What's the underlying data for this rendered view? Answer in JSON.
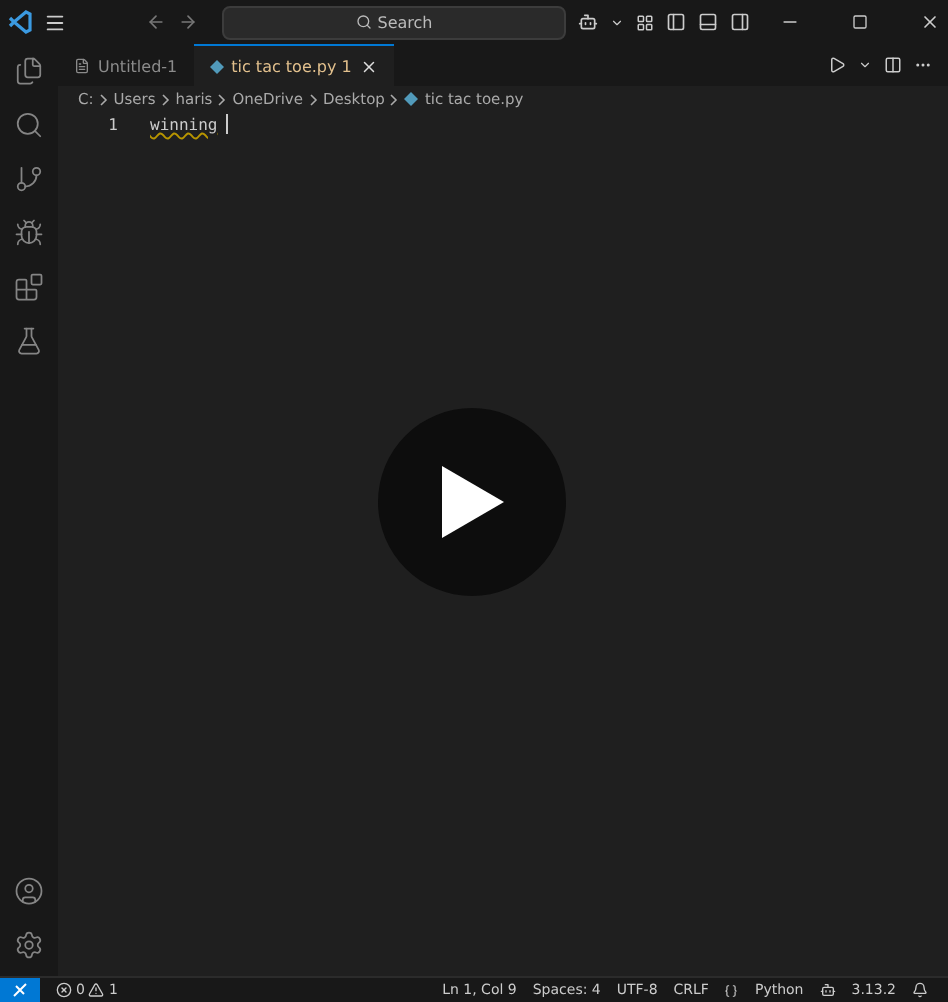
{
  "title_bar": {
    "search_placeholder": "Search"
  },
  "activity_bar": {
    "items": [
      {
        "kind": "explorer",
        "selected": false
      },
      {
        "kind": "search",
        "selected": false
      },
      {
        "kind": "source-control",
        "selected": false
      },
      {
        "kind": "run",
        "selected": false
      },
      {
        "kind": "extensions",
        "selected": false
      },
      {
        "kind": "testing",
        "selected": false
      }
    ]
  },
  "tabs": [
    {
      "label": "Untitled-1",
      "selected": false,
      "kind": "text"
    },
    {
      "label": "tic tac toe.py",
      "selected": true,
      "kind": "python",
      "problems": "1"
    }
  ],
  "breadcrumb": [
    "C:",
    "Users",
    "haris",
    "OneDrive",
    "Desktop",
    "tic tac toe.py"
  ],
  "editor": {
    "lines": [
      {
        "number": "1",
        "text": "winning"
      }
    ]
  },
  "status_bar": {
    "errors": "0",
    "warnings": "1",
    "items": [
      "Ln 1, Col 9",
      "Spaces: 4",
      "UTF-8",
      "CRLF",
      "Python",
      "3.13.2"
    ]
  }
}
